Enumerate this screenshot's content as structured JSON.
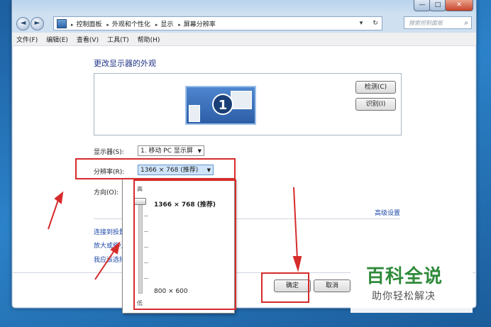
{
  "window": {
    "buttons": {
      "min": "—",
      "max": "□",
      "close": "✕"
    }
  },
  "address": {
    "back_icon": "◄",
    "forward_icon": "►",
    "crumbs": [
      "控制面板",
      "外观和个性化",
      "显示",
      "屏幕分辨率"
    ],
    "separator": "▸",
    "dropdown_icon": "▾",
    "refresh_icon": "↻",
    "search_placeholder": "搜索控制面板",
    "search_icon": "⌕"
  },
  "menu": [
    "文件(F)",
    "编辑(E)",
    "查看(V)",
    "工具(T)",
    "帮助(H)"
  ],
  "main": {
    "heading": "更改显示器的外观",
    "monitor_number": "1",
    "detect_button": "检测(C)",
    "identify_button": "识别(I)",
    "display_label": "显示器(S):",
    "display_value": "1. 移动 PC 显示屏",
    "resolution_label": "分辨率(R):",
    "resolution_value": "1366 × 768 (推荐)",
    "orientation_label": "方向(O):",
    "advanced_link": "高级设置",
    "links": [
      "连接到投影仪 (",
      "放大或缩小文本",
      "我应该选择什么"
    ],
    "ok_button": "确定",
    "cancel_button": "取消",
    "combo_arrow": "▼"
  },
  "resolution_dropdown": {
    "high_label": "高",
    "low_label": "低",
    "current": "1366 × 768 (推荐)",
    "minimum": "800 × 600",
    "slider_position": 1.0
  },
  "watermark": {
    "title": "百科全说",
    "subtitle": "助你轻松解决"
  },
  "colors": {
    "heading": "#1e3287",
    "link": "#1f49a8",
    "annotation_red": "#d62b2b",
    "watermark_green": "#2f8a3a"
  }
}
